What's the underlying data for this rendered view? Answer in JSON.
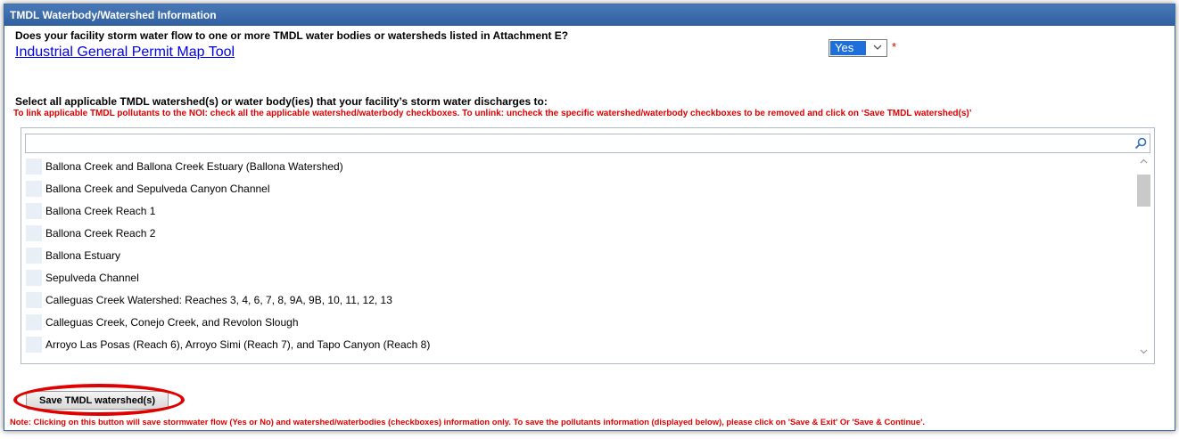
{
  "section": {
    "title": "TMDL Waterbody/Watershed Information"
  },
  "question": {
    "text": "Does your facility storm water flow to one or more TMDL water bodies or watersheds listed in Attachment E?",
    "link_text": "Industrial General Permit Map Tool",
    "select_value": "Yes",
    "required_marker": "*"
  },
  "selection": {
    "label": "Select all applicable TMDL watershed(s) or water body(ies) that your facility’s storm water discharges to:",
    "instructions": "To link applicable TMDL pollutants to the NOI: check all the applicable watershed/waterbody checkboxes. To unlink: uncheck the specific watershed/waterbody checkboxes to be removed and click on ‘Save TMDL watershed(s)’",
    "search_value": "",
    "items": [
      {
        "label": "Ballona Creek and Ballona Creek Estuary (Ballona Watershed)",
        "checked": false
      },
      {
        "label": "Ballona Creek and Sepulveda Canyon Channel",
        "checked": false
      },
      {
        "label": "Ballona Creek Reach 1",
        "checked": false
      },
      {
        "label": "Ballona Creek Reach 2",
        "checked": false
      },
      {
        "label": "Ballona Estuary",
        "checked": false
      },
      {
        "label": "Sepulveda Channel",
        "checked": false
      },
      {
        "label": "Calleguas Creek Watershed: Reaches 3, 4, 6, 7, 8, 9A, 9B, 10, 11, 12, 13",
        "checked": false
      },
      {
        "label": "Calleguas Creek, Conejo Creek, and Revolon Slough",
        "checked": false
      },
      {
        "label": "Arroyo Las Posas (Reach 6), Arroyo Simi (Reach 7), and Tapo Canyon (Reach 8)",
        "checked": false
      }
    ]
  },
  "actions": {
    "save_label": "Save TMDL watershed(s)",
    "note": "Note: Clicking on this button will save stormwater flow (Yes or No) and watershed/waterbodies (checkboxes) information only. To save the pollutants information (displayed below), please click on 'Save & Exit' Or 'Save & Continue'."
  },
  "colors": {
    "header": "#2f5f9f",
    "warning": "#e00000",
    "link": "#0000ee",
    "select_highlight": "#1e6fd9",
    "annotation_oval": "#e00000"
  },
  "icons": {
    "search": "search-icon",
    "scroll_up": "chevron-up-icon",
    "scroll_down": "chevron-down-icon",
    "dropdown": "chevron-down-icon"
  }
}
